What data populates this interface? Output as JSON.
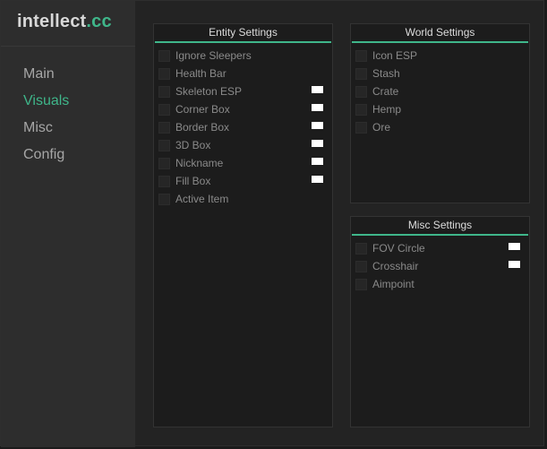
{
  "app": {
    "logo_main": "intellect",
    "logo_accent": ".cc",
    "accent_color": "#3fb68a"
  },
  "sidebar": {
    "items": [
      {
        "label": "Main",
        "active": false
      },
      {
        "label": "Visuals",
        "active": true
      },
      {
        "label": "Misc",
        "active": false
      },
      {
        "label": "Config",
        "active": false
      }
    ]
  },
  "entity_settings": {
    "title": "Entity Settings",
    "items": [
      {
        "label": "Ignore Sleepers",
        "checked": false,
        "color": null
      },
      {
        "label": "Health Bar",
        "checked": false,
        "color": null
      },
      {
        "label": "Skeleton ESP",
        "checked": false,
        "color": "#ffffff"
      },
      {
        "label": "Corner Box",
        "checked": false,
        "color": "#ffffff"
      },
      {
        "label": "Border Box",
        "checked": false,
        "color": "#ffffff"
      },
      {
        "label": "3D Box",
        "checked": false,
        "color": "#ffffff"
      },
      {
        "label": "Nickname",
        "checked": false,
        "color": "#ffffff"
      },
      {
        "label": "Fill Box",
        "checked": false,
        "color": "#ffffff"
      },
      {
        "label": "Active Item",
        "checked": false,
        "color": null
      }
    ]
  },
  "world_settings": {
    "title": "World Settings",
    "items": [
      {
        "label": "Icon ESP",
        "checked": false,
        "color": null
      },
      {
        "label": "Stash",
        "checked": false,
        "color": null
      },
      {
        "label": "Crate",
        "checked": false,
        "color": null
      },
      {
        "label": "Hemp",
        "checked": false,
        "color": null
      },
      {
        "label": "Ore",
        "checked": false,
        "color": null
      }
    ]
  },
  "misc_settings": {
    "title": "Misc Settings",
    "items": [
      {
        "label": "FOV Circle",
        "checked": false,
        "color": "#ffffff"
      },
      {
        "label": "Crosshair",
        "checked": false,
        "color": "#ffffff"
      },
      {
        "label": "Aimpoint",
        "checked": false,
        "color": null
      }
    ]
  }
}
